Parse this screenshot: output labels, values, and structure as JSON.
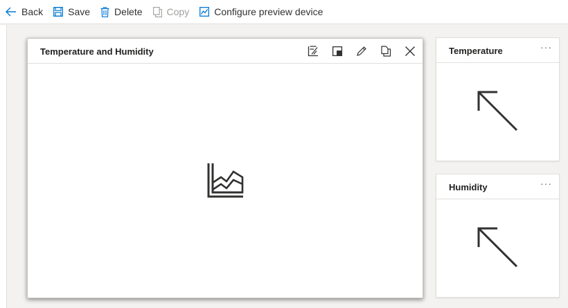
{
  "toolbar": {
    "back_label": "Back",
    "save_label": "Save",
    "delete_label": "Delete",
    "copy_label": "Copy",
    "configure_label": "Configure preview device"
  },
  "tiles": {
    "main": {
      "title": "Temperature and Humidity",
      "actions": [
        "chart-settings-icon",
        "size-icon",
        "edit-pencil-icon",
        "copy-icon",
        "close-icon"
      ],
      "placeholder_icon": "area-chart-icon"
    },
    "temperature": {
      "title": "Temperature",
      "more_label": "···",
      "placeholder_icon": "arrow-up-left-icon"
    },
    "humidity": {
      "title": "Humidity",
      "more_label": "···",
      "placeholder_icon": "arrow-up-left-icon"
    }
  },
  "colors": {
    "accent": "#0078d4",
    "disabled": "#a19f9d",
    "text": "#323130"
  }
}
